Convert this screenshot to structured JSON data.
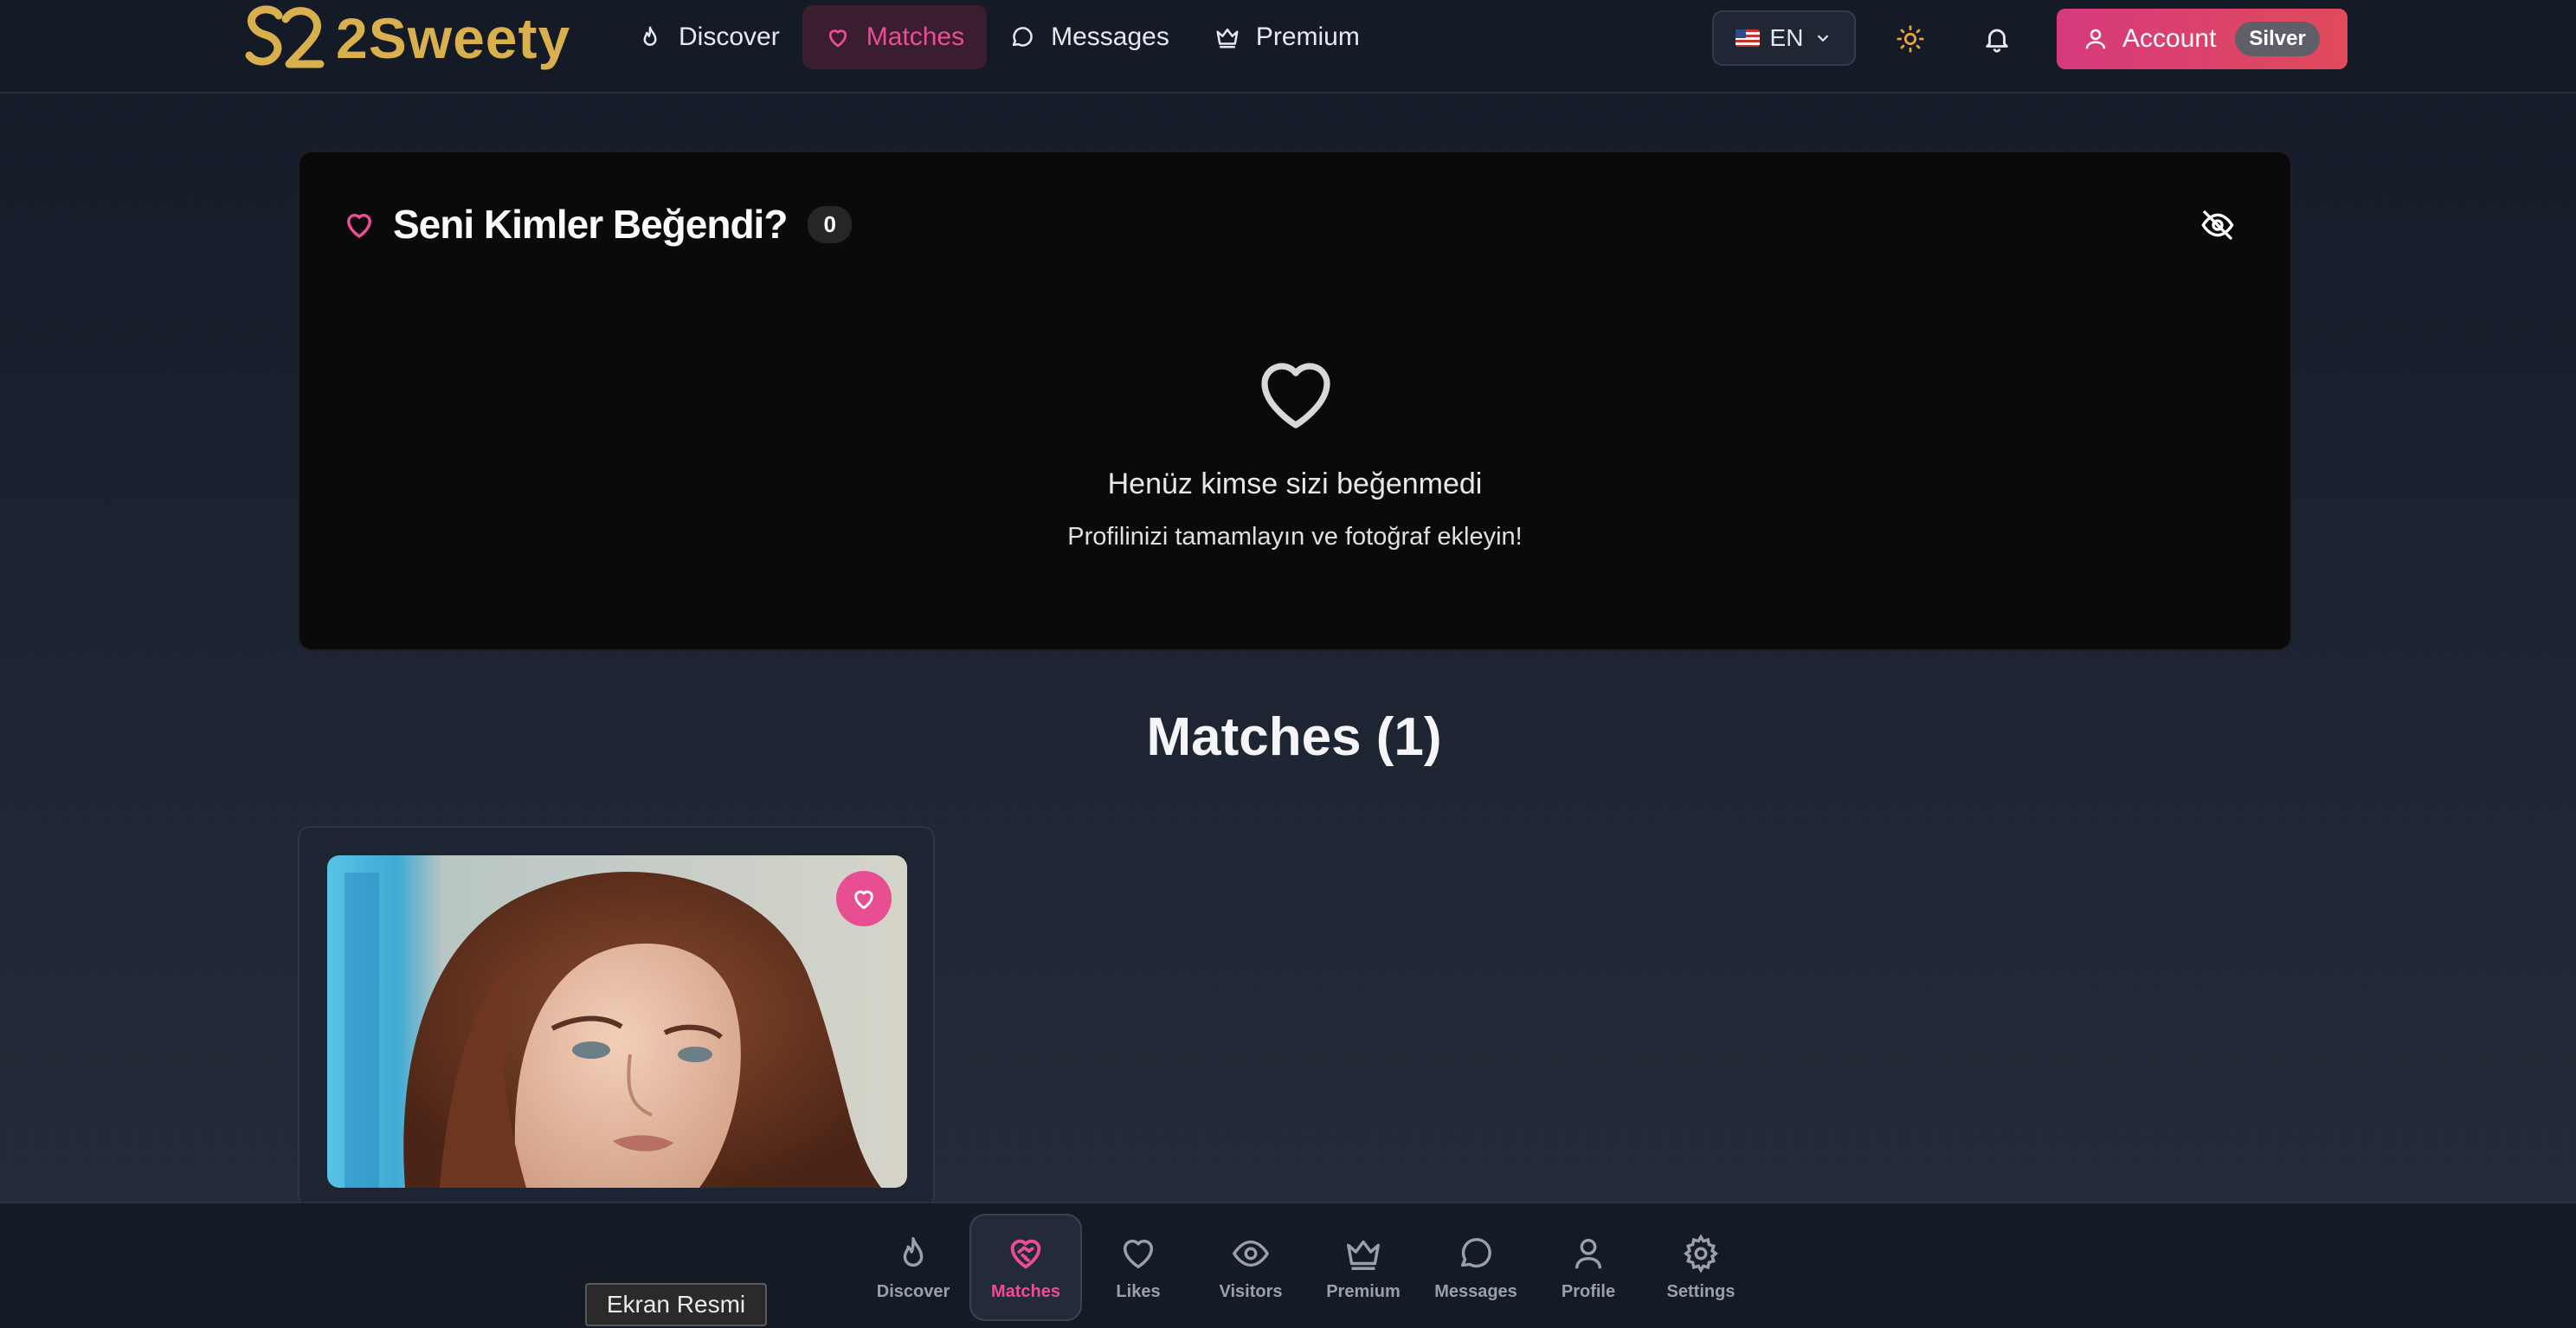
{
  "brand": {
    "name": "2Sweety",
    "color": "#d9b04e"
  },
  "nav": {
    "items": [
      {
        "label": "Discover",
        "icon": "flame-icon"
      },
      {
        "label": "Matches",
        "icon": "heart-icon",
        "active": true
      },
      {
        "label": "Messages",
        "icon": "chat-icon"
      },
      {
        "label": "Premium",
        "icon": "crown-icon"
      }
    ]
  },
  "header": {
    "language": "EN",
    "account_label": "Account",
    "tier_badge": "Silver"
  },
  "likes": {
    "title": "Seni Kimler Beğendi?",
    "count": "0",
    "empty_title": "Henüz kimse sizi beğenmedi",
    "empty_subtitle": "Profilinizi tamamlayın ve fotoğraf ekleyin!"
  },
  "matches": {
    "title": "Matches (1)"
  },
  "bottom_nav": {
    "items": [
      {
        "label": "Discover",
        "icon": "flame-icon"
      },
      {
        "label": "Matches",
        "icon": "heart-handshake-icon",
        "active": true
      },
      {
        "label": "Likes",
        "icon": "heart-icon"
      },
      {
        "label": "Visitors",
        "icon": "eye-icon"
      },
      {
        "label": "Premium",
        "icon": "crown-icon"
      },
      {
        "label": "Messages",
        "icon": "chat-icon"
      },
      {
        "label": "Profile",
        "icon": "user-icon"
      },
      {
        "label": "Settings",
        "icon": "gear-icon"
      }
    ]
  },
  "tooltip": {
    "text": "Ekran Resmi"
  },
  "colors": {
    "accent": "#ec4d97",
    "account_gradient_start": "#d63a7d",
    "account_gradient_end": "#e04a5a"
  }
}
